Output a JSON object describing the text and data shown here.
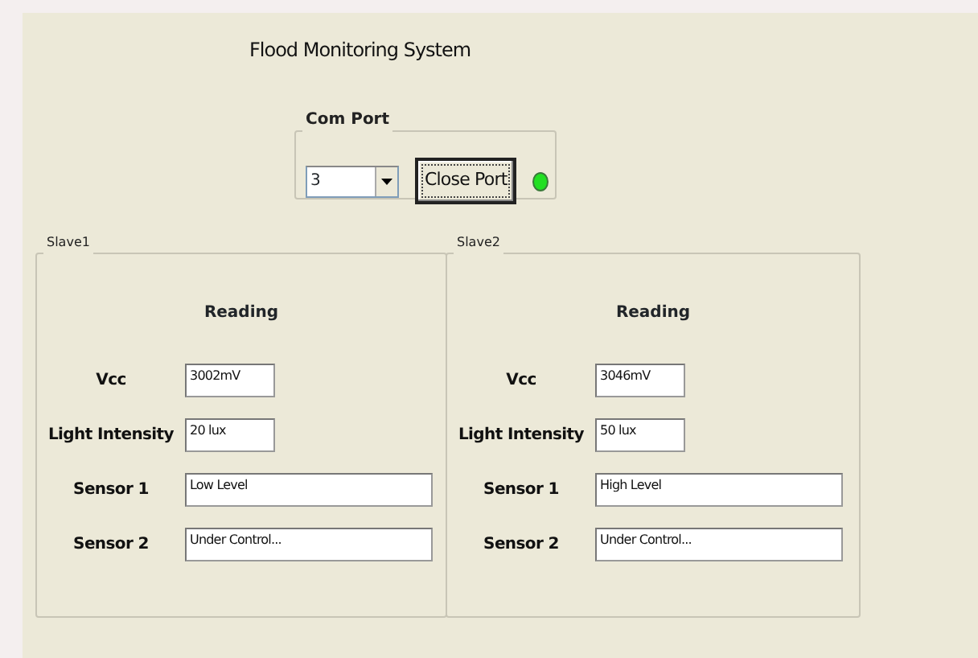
{
  "title": "Flood Monitoring System",
  "com_port": {
    "legend": "Com Port",
    "value": "3",
    "button": "Close Port",
    "connected": true
  },
  "slaves": [
    {
      "legend": "Slave1",
      "heading": "Reading",
      "fields": [
        {
          "label": "Vcc",
          "value": "3002mV",
          "kind": "short"
        },
        {
          "label": "Light Intensity",
          "value": "20 lux",
          "kind": "short"
        },
        {
          "label": "Sensor 1",
          "value": "Low Level",
          "kind": "long"
        },
        {
          "label": "Sensor 2",
          "value": "Under Control...",
          "kind": "long"
        }
      ]
    },
    {
      "legend": "Slave2",
      "heading": "Reading",
      "fields": [
        {
          "label": "Vcc",
          "value": "3046mV",
          "kind": "short"
        },
        {
          "label": "Light Intensity",
          "value": "50 lux",
          "kind": "short"
        },
        {
          "label": "Sensor 1",
          "value": "High Level",
          "kind": "long"
        },
        {
          "label": "Sensor 2",
          "value": "Under Control...",
          "kind": "long"
        }
      ]
    }
  ]
}
